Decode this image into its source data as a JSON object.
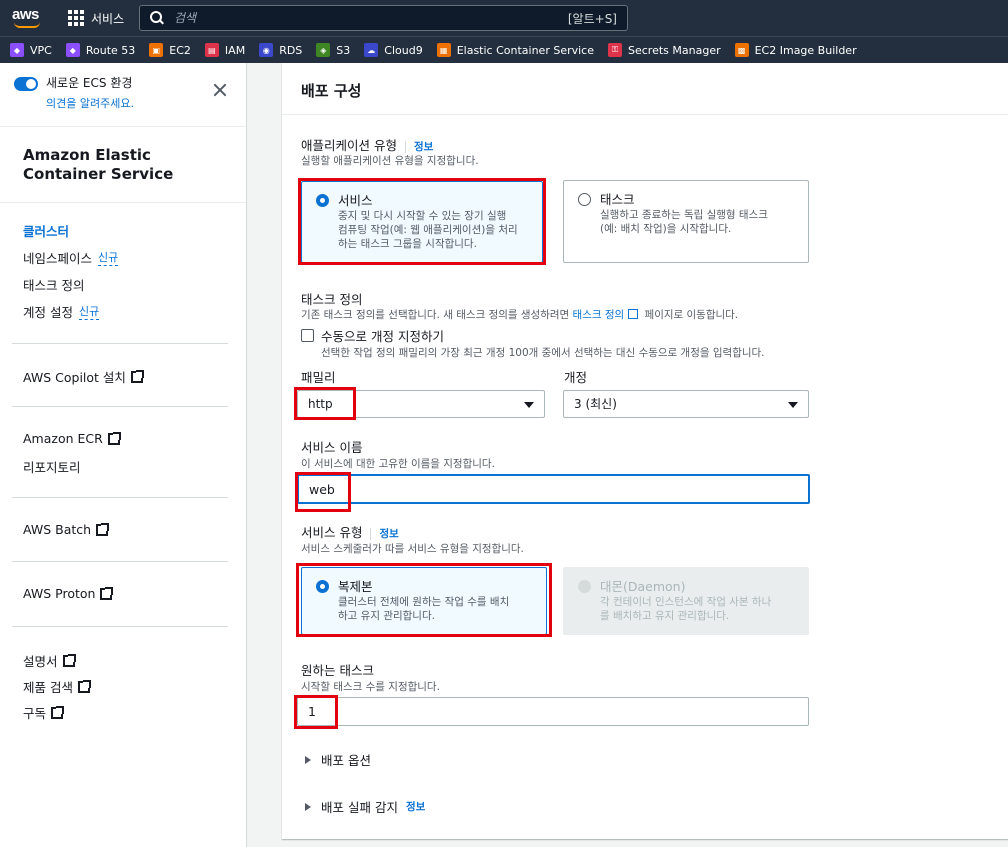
{
  "topnav": {
    "logo_text": "aws",
    "services_label": "서비스",
    "search_placeholder": "검색",
    "search_shortcut": "[알트+S]"
  },
  "favorites": [
    {
      "label": "VPC",
      "color": "#8c4fff"
    },
    {
      "label": "Route 53",
      "color": "#8c4fff"
    },
    {
      "label": "EC2",
      "color": "#ed7100"
    },
    {
      "label": "IAM",
      "color": "#dd344c"
    },
    {
      "label": "RDS",
      "color": "#3b48cc"
    },
    {
      "label": "S3",
      "color": "#3f8624"
    },
    {
      "label": "Cloud9",
      "color": "#3b48cc"
    },
    {
      "label": "Elastic Container Service",
      "color": "#ed7100"
    },
    {
      "label": "Secrets Manager",
      "color": "#dd344c"
    },
    {
      "label": "EC2 Image Builder",
      "color": "#ed7100"
    }
  ],
  "sidebar": {
    "toggle_title": "새로운 ECS 환경",
    "toggle_sub": "의견을 알려주세요.",
    "title": "Amazon Elastic Container Service",
    "nav": {
      "clusters": "클러스터",
      "namespaces": "네임스페이스",
      "task_defs": "태스크 정의",
      "account_settings": "계정 설정",
      "new_badge": "신규"
    },
    "copilot": "AWS Copilot 설치",
    "ecr": "Amazon ECR",
    "repositories": "리포지토리",
    "batch": "AWS Batch",
    "proton": "AWS Proton",
    "docs": "설명서",
    "product_search": "제품 검색",
    "subscribe": "구독"
  },
  "main": {
    "panel_title": "배포 구성",
    "info_label": "정보",
    "app_type": {
      "label": "애플리케이션 유형",
      "desc": "실행할 애플리케이션 유형을 지정합니다.",
      "service_title": "서비스",
      "service_desc_1": "중지 및 다시 시작할 수 있는 장기 실행",
      "service_desc_2": "컴퓨팅 작업(예: 웹 애플리케이션)을 처리",
      "service_desc_3": "하는 태스크 그룹을 시작합니다.",
      "task_title": "태스크",
      "task_desc_1": "실행하고 종료하는 독립 실행형 태스크",
      "task_desc_2": "(예: 배치 작업)을 시작합니다."
    },
    "task_def": {
      "label": "태스크 정의",
      "desc_prefix": "기존 태스크 정의를 선택합니다. 새 태스크 정의를 생성하려면",
      "desc_link": "태스크 정의",
      "desc_suffix": "페이지로 이동합니다.",
      "manual_label": "수동으로 개정 지정하기",
      "manual_desc": "선택한 작업 정의 패밀리의 가장 최근 개정 100개 중에서 선택하는 대신 수동으로 개정을 입력합니다."
    },
    "family": {
      "label": "패밀리",
      "value": "http"
    },
    "revision": {
      "label": "개정",
      "value": "3 (최신)"
    },
    "service_name": {
      "label": "서비스 이름",
      "desc": "이 서비스에 대한 고유한 이름을 지정합니다.",
      "value": "web"
    },
    "service_type": {
      "label": "서비스 유형",
      "desc": "서비스 스케줄러가 따를 서비스 유형을 지정합니다.",
      "replica_title": "복제본",
      "replica_desc_1": "클러스터 전체에 원하는 작업 수를 배치",
      "replica_desc_2": "하고 유지 관리합니다.",
      "daemon_title": "대몬(Daemon)",
      "daemon_desc_1": "각 컨테이너 인스턴스에 작업 사본 하나",
      "daemon_desc_2": "를 배치하고 유지 관리합니다."
    },
    "desired_tasks": {
      "label": "원하는 태스크",
      "desc": "시작할 태스크 수를 지정합니다.",
      "value": "1"
    },
    "deploy_options": "배포 옵션",
    "deploy_failure": "배포 실패 감지"
  }
}
